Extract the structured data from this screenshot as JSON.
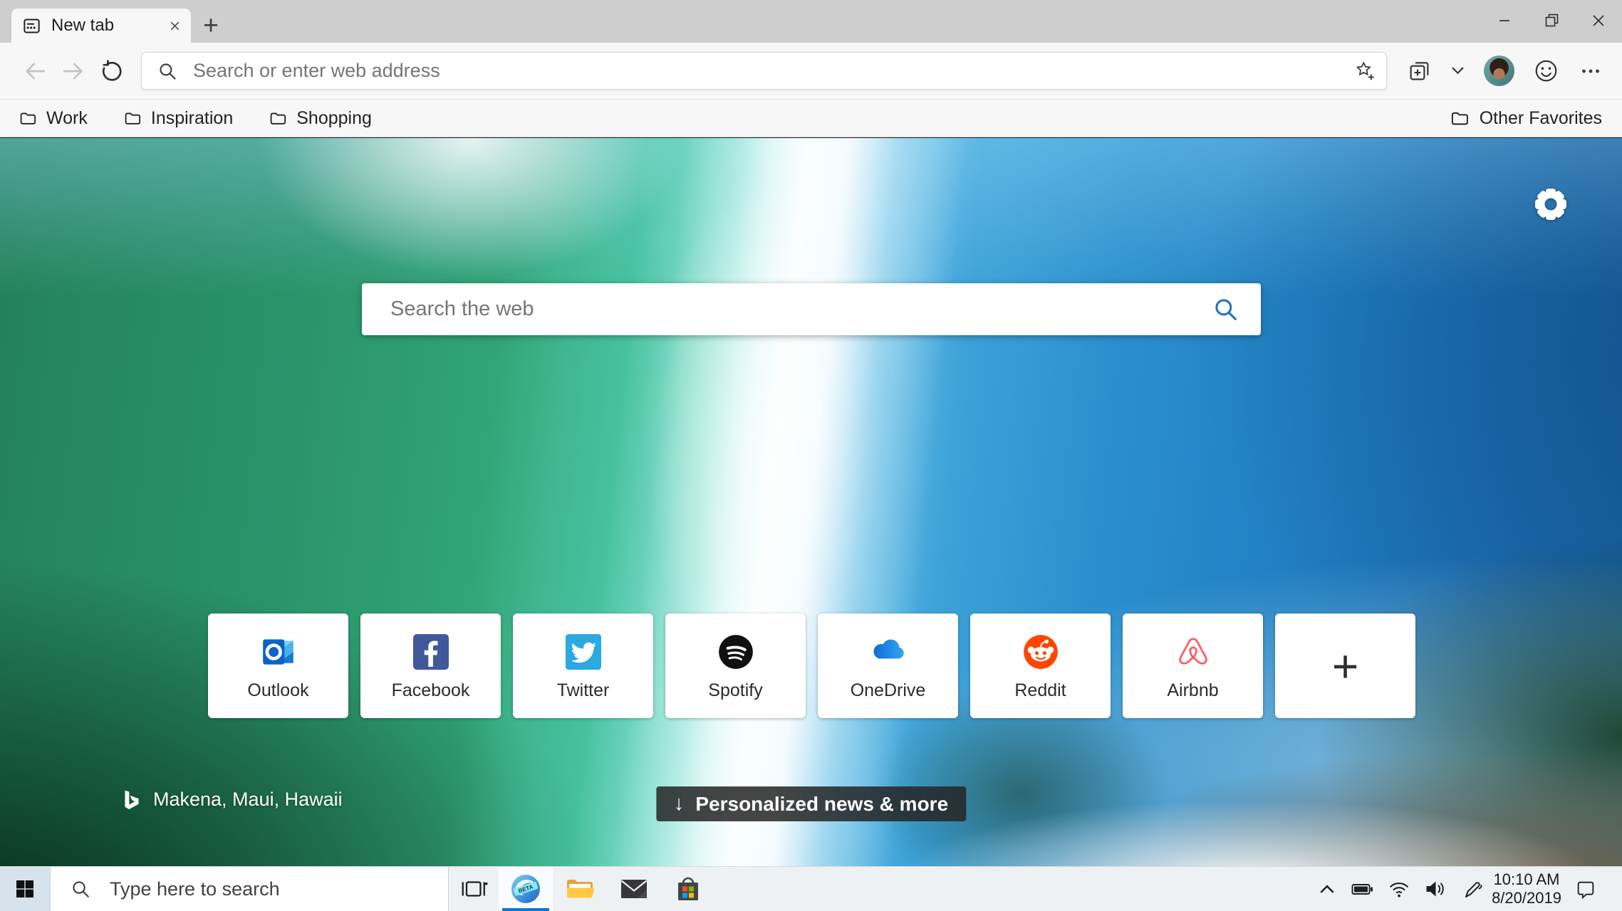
{
  "browser": {
    "tab": {
      "title": "New tab"
    },
    "new_tab_button_glyph": "+",
    "address_bar": {
      "placeholder": "Search or enter web address"
    }
  },
  "favorites_bar": {
    "items": [
      {
        "label": "Work"
      },
      {
        "label": "Inspiration"
      },
      {
        "label": "Shopping"
      }
    ],
    "other_favorites": "Other Favorites"
  },
  "new_tab_page": {
    "search": {
      "placeholder": "Search the web"
    },
    "quick_links": [
      {
        "label": "Outlook",
        "brand_color": "#0a63c9"
      },
      {
        "label": "Facebook",
        "brand_color": "#41599b"
      },
      {
        "label": "Twitter",
        "brand_color": "#2ba9e0"
      },
      {
        "label": "Spotify",
        "brand_color": "#101010"
      },
      {
        "label": "OneDrive",
        "brand_color": "#0f6bd7"
      },
      {
        "label": "Reddit",
        "brand_color": "#ff4500"
      },
      {
        "label": "Airbnb",
        "brand_color": "#ff5a5f"
      }
    ],
    "add_shortcut_glyph": "+",
    "location_credit": "Makena, Maui, Hawaii",
    "news_button": {
      "arrow": "↓",
      "label": "Personalized news & more"
    }
  },
  "taskbar": {
    "search_placeholder": "Type here to search",
    "apps": [
      {
        "name": "Task View"
      },
      {
        "name": "Microsoft Edge Beta",
        "badge": "BETA",
        "active": true
      },
      {
        "name": "File Explorer"
      },
      {
        "name": "Mail"
      },
      {
        "name": "Microsoft Store"
      }
    ],
    "clock": {
      "time": "10:10 AM",
      "date": "8/20/2019"
    }
  },
  "colors": {
    "accent": "#0078d7",
    "tab_bar_bg": "#cecece",
    "chrome_bg": "#f7f7f7",
    "taskbar_bg": "#eef1f3",
    "search_icon_blue": "#1b72c0",
    "news_button_bg": "rgba(37,37,37,0.85)",
    "ms_logo": [
      "#f25022",
      "#7fba00",
      "#00a4ef",
      "#ffb900"
    ]
  }
}
